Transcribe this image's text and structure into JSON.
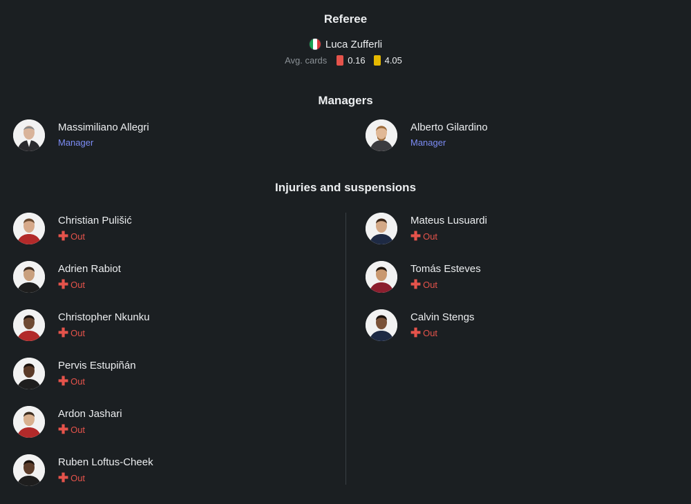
{
  "referee": {
    "title": "Referee",
    "name": "Luca Zufferli",
    "avg_cards_label": "Avg. cards",
    "red_cards": "0.16",
    "yellow_cards": "4.05",
    "colors": {
      "red": "#e5534b",
      "yellow": "#e5b800"
    }
  },
  "managers": {
    "title": "Managers",
    "home": {
      "name": "Massimiliano Allegri",
      "role": "Manager"
    },
    "away": {
      "name": "Alberto Gilardino",
      "role": "Manager"
    }
  },
  "injuries": {
    "title": "Injuries and suspensions",
    "home": [
      {
        "name": "Christian Pulišić",
        "status": "Out"
      },
      {
        "name": "Adrien Rabiot",
        "status": "Out"
      },
      {
        "name": "Christopher Nkunku",
        "status": "Out"
      },
      {
        "name": "Pervis Estupiñán",
        "status": "Out"
      },
      {
        "name": "Ardon Jashari",
        "status": "Out"
      },
      {
        "name": "Ruben Loftus-Cheek",
        "status": "Out"
      }
    ],
    "away": [
      {
        "name": "Mateus Lusuardi",
        "status": "Out"
      },
      {
        "name": "Tomás Esteves",
        "status": "Out"
      },
      {
        "name": "Calvin Stengs",
        "status": "Out"
      }
    ]
  },
  "icons": {
    "status_icon": "cross-icon",
    "flag": "italy-flag-icon"
  },
  "colors": {
    "background": "#1b1f22",
    "manager_role": "#7c8cf5",
    "out": "#e5534b"
  }
}
